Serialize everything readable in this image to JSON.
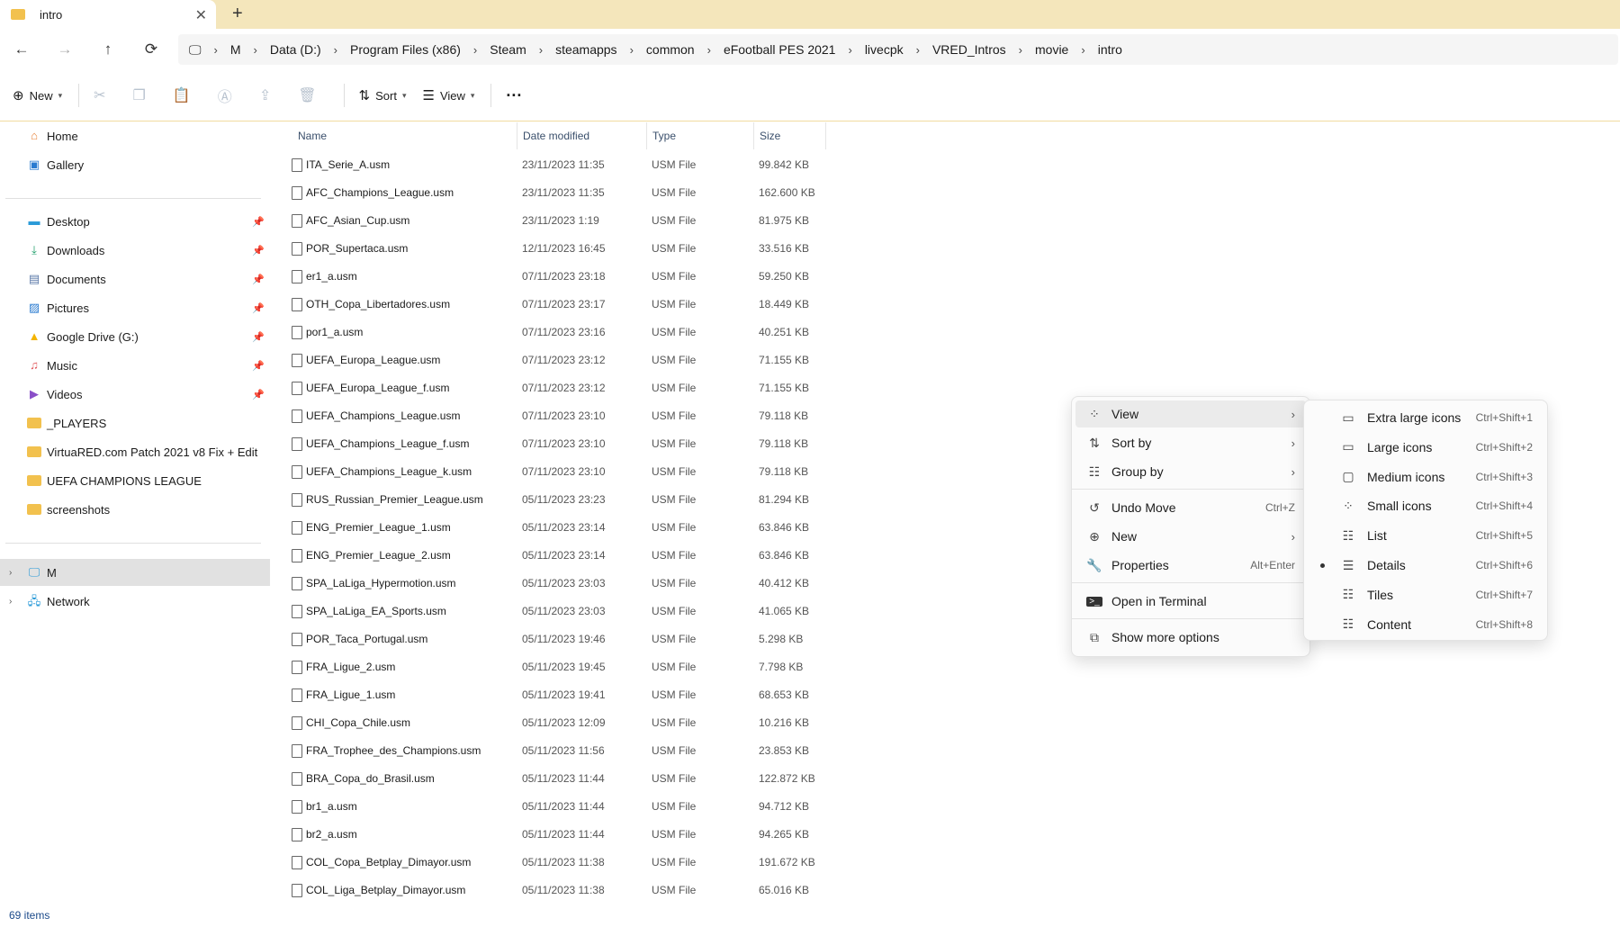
{
  "tab": {
    "title": "intro",
    "close_icon": "✕",
    "new_tab": "+"
  },
  "nav": {
    "back": "←",
    "forward": "→",
    "up": "↑",
    "refresh": "⟳"
  },
  "address": {
    "crumbs": [
      "M",
      "Data (D:)",
      "Program Files (x86)",
      "Steam",
      "steamapps",
      "common",
      "eFootball PES 2021",
      "livecpk",
      "VRED_Intros",
      "movie",
      "intro"
    ]
  },
  "commandbar": {
    "new_label": "New",
    "sort_label": "Sort",
    "view_label": "View",
    "more": "···"
  },
  "sidebar": {
    "home": "Home",
    "gallery": "Gallery",
    "desktop": "Desktop",
    "downloads": "Downloads",
    "documents": "Documents",
    "pictures": "Pictures",
    "gdrive": "Google Drive (G:)",
    "music": "Music",
    "videos": "Videos",
    "players": "_PLAYERS",
    "virtuared": "VirtuaRED.com Patch 2021 v8 Fix + Edit",
    "ucl": "UEFA CHAMPIONS LEAGUE",
    "screenshots": "screenshots",
    "m": "M",
    "network": "Network"
  },
  "columns": {
    "name": "Name",
    "date": "Date modified",
    "type": "Type",
    "size": "Size"
  },
  "files": [
    {
      "name": "ITA_Serie_A.usm",
      "date": "23/11/2023 11:35",
      "type": "USM File",
      "size": "99.842 KB"
    },
    {
      "name": "AFC_Champions_League.usm",
      "date": "23/11/2023 11:35",
      "type": "USM File",
      "size": "162.600 KB"
    },
    {
      "name": "AFC_Asian_Cup.usm",
      "date": "23/11/2023 1:19",
      "type": "USM File",
      "size": "81.975 KB"
    },
    {
      "name": "POR_Supertaca.usm",
      "date": "12/11/2023 16:45",
      "type": "USM File",
      "size": "33.516 KB"
    },
    {
      "name": "er1_a.usm",
      "date": "07/11/2023 23:18",
      "type": "USM File",
      "size": "59.250 KB"
    },
    {
      "name": "OTH_Copa_Libertadores.usm",
      "date": "07/11/2023 23:17",
      "type": "USM File",
      "size": "18.449 KB"
    },
    {
      "name": "por1_a.usm",
      "date": "07/11/2023 23:16",
      "type": "USM File",
      "size": "40.251 KB"
    },
    {
      "name": "UEFA_Europa_League.usm",
      "date": "07/11/2023 23:12",
      "type": "USM File",
      "size": "71.155 KB"
    },
    {
      "name": "UEFA_Europa_League_f.usm",
      "date": "07/11/2023 23:12",
      "type": "USM File",
      "size": "71.155 KB"
    },
    {
      "name": "UEFA_Champions_League.usm",
      "date": "07/11/2023 23:10",
      "type": "USM File",
      "size": "79.118 KB"
    },
    {
      "name": "UEFA_Champions_League_f.usm",
      "date": "07/11/2023 23:10",
      "type": "USM File",
      "size": "79.118 KB"
    },
    {
      "name": "UEFA_Champions_League_k.usm",
      "date": "07/11/2023 23:10",
      "type": "USM File",
      "size": "79.118 KB"
    },
    {
      "name": "RUS_Russian_Premier_League.usm",
      "date": "05/11/2023 23:23",
      "type": "USM File",
      "size": "81.294 KB"
    },
    {
      "name": "ENG_Premier_League_1.usm",
      "date": "05/11/2023 23:14",
      "type": "USM File",
      "size": "63.846 KB"
    },
    {
      "name": "ENG_Premier_League_2.usm",
      "date": "05/11/2023 23:14",
      "type": "USM File",
      "size": "63.846 KB"
    },
    {
      "name": "SPA_LaLiga_Hypermotion.usm",
      "date": "05/11/2023 23:03",
      "type": "USM File",
      "size": "40.412 KB"
    },
    {
      "name": "SPA_LaLiga_EA_Sports.usm",
      "date": "05/11/2023 23:03",
      "type": "USM File",
      "size": "41.065 KB"
    },
    {
      "name": "POR_Taca_Portugal.usm",
      "date": "05/11/2023 19:46",
      "type": "USM File",
      "size": "5.298 KB"
    },
    {
      "name": "FRA_Ligue_2.usm",
      "date": "05/11/2023 19:45",
      "type": "USM File",
      "size": "7.798 KB"
    },
    {
      "name": "FRA_Ligue_1.usm",
      "date": "05/11/2023 19:41",
      "type": "USM File",
      "size": "68.653 KB"
    },
    {
      "name": "CHI_Copa_Chile.usm",
      "date": "05/11/2023 12:09",
      "type": "USM File",
      "size": "10.216 KB"
    },
    {
      "name": "FRA_Trophee_des_Champions.usm",
      "date": "05/11/2023 11:56",
      "type": "USM File",
      "size": "23.853 KB"
    },
    {
      "name": "BRA_Copa_do_Brasil.usm",
      "date": "05/11/2023 11:44",
      "type": "USM File",
      "size": "122.872 KB"
    },
    {
      "name": "br1_a.usm",
      "date": "05/11/2023 11:44",
      "type": "USM File",
      "size": "94.712 KB"
    },
    {
      "name": "br2_a.usm",
      "date": "05/11/2023 11:44",
      "type": "USM File",
      "size": "94.265 KB"
    },
    {
      "name": "COL_Copa_Betplay_Dimayor.usm",
      "date": "05/11/2023 11:38",
      "type": "USM File",
      "size": "191.672 KB"
    },
    {
      "name": "COL_Liga_Betplay_Dimayor.usm",
      "date": "05/11/2023 11:38",
      "type": "USM File",
      "size": "65.016 KB"
    }
  ],
  "status": {
    "items": "69 items"
  },
  "context_menu": {
    "view": "View",
    "sort_by": "Sort by",
    "group_by": "Group by",
    "undo_move": "Undo Move",
    "undo_shortcut": "Ctrl+Z",
    "new": "New",
    "properties": "Properties",
    "properties_shortcut": "Alt+Enter",
    "terminal": "Open in Terminal",
    "more_options": "Show more options"
  },
  "view_submenu": [
    {
      "label": "Extra large icons",
      "shortcut": "Ctrl+Shift+1",
      "icon": "▭"
    },
    {
      "label": "Large icons",
      "shortcut": "Ctrl+Shift+2",
      "icon": "▭"
    },
    {
      "label": "Medium icons",
      "shortcut": "Ctrl+Shift+3",
      "icon": "▢"
    },
    {
      "label": "Small icons",
      "shortcut": "Ctrl+Shift+4",
      "icon": "⁘"
    },
    {
      "label": "List",
      "shortcut": "Ctrl+Shift+5",
      "icon": "☷"
    },
    {
      "label": "Details",
      "shortcut": "Ctrl+Shift+6",
      "icon": "☰"
    },
    {
      "label": "Tiles",
      "shortcut": "Ctrl+Shift+7",
      "icon": "☷"
    },
    {
      "label": "Content",
      "shortcut": "Ctrl+Shift+8",
      "icon": "☷"
    }
  ],
  "colors": {
    "tabbar": "#f4e6bb",
    "folder": "#f2c14e",
    "accent": "#0067c0"
  }
}
